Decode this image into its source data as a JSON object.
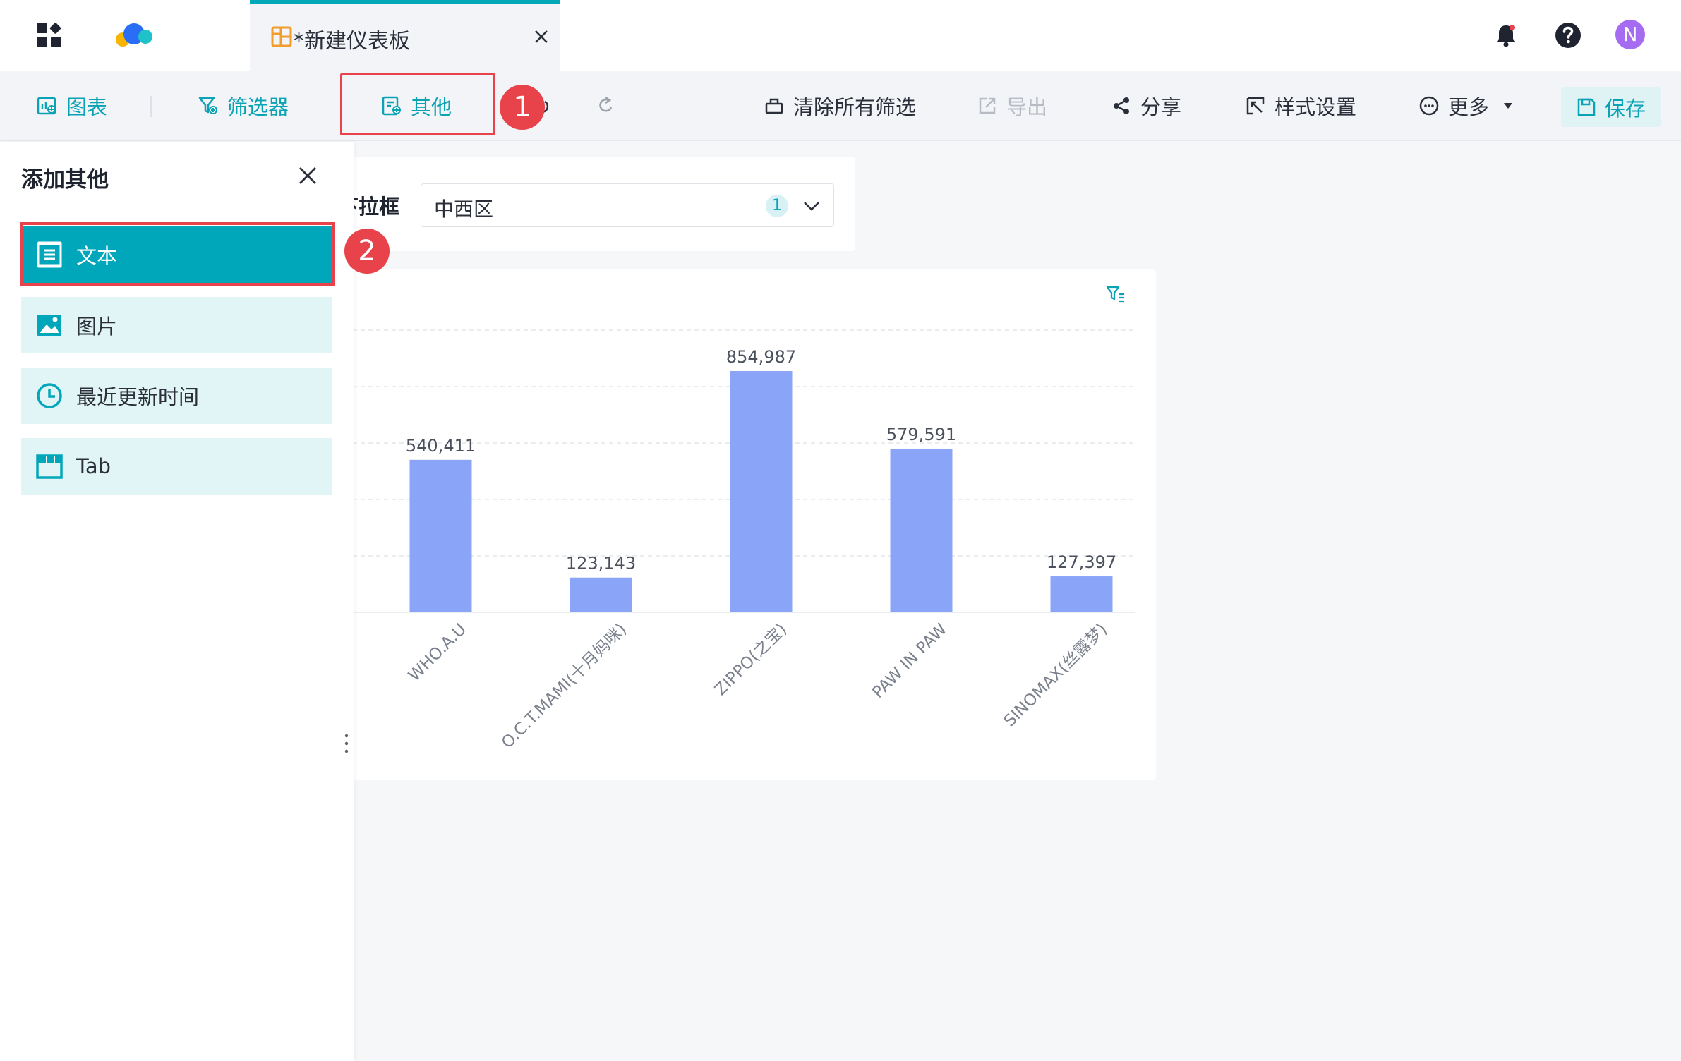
{
  "header": {
    "tab_title": "*新建仪表板",
    "avatar_letter": "N"
  },
  "toolbar": {
    "chart_label": "图表",
    "filter_label": "筛选器",
    "other_label": "其他",
    "clear_filters_label": "清除所有筛选",
    "export_label": "导出",
    "share_label": "分享",
    "style_label": "样式设置",
    "more_label": "更多",
    "save_label": "保存"
  },
  "annotations": {
    "step1": "1",
    "step2": "2"
  },
  "side_panel": {
    "title": "添加其他",
    "items": [
      {
        "label": "文本",
        "icon": "text-icon"
      },
      {
        "label": "图片",
        "icon": "image-icon"
      },
      {
        "label": "最近更新时间",
        "icon": "clock-icon"
      },
      {
        "label": "Tab",
        "icon": "tab-icon"
      }
    ]
  },
  "filter_widget": {
    "label": "下拉框",
    "value": "中西区",
    "selected_count": "1"
  },
  "colors": {
    "accent": "#00a6b9",
    "bar": "#8aa4f8",
    "highlight": "#e8434a"
  },
  "chart_data": {
    "type": "bar",
    "categories": [
      "WHO.A.U",
      "O.C.T.MAMI(十月妈咪)",
      "ZIPPO(之宝)",
      "PAW IN PAW",
      "SINOMAX(丝露梦)"
    ],
    "values": [
      540411,
      123143,
      854987,
      579591,
      127397
    ],
    "data_labels": [
      "540,411",
      "123,143",
      "854,987",
      "579,591",
      "127,397"
    ],
    "ylim": [
      0,
      1000000
    ],
    "grid": true
  }
}
